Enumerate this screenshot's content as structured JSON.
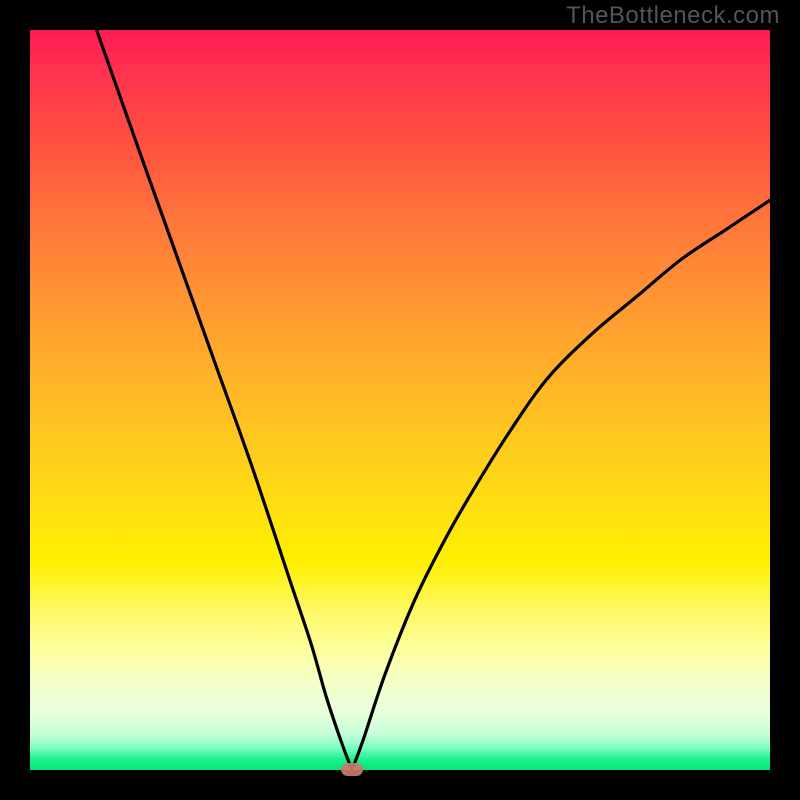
{
  "watermark": "TheBottleneck.com",
  "chart_data": {
    "type": "line",
    "title": "",
    "xlabel": "",
    "ylabel": "",
    "xlim": [
      0,
      100
    ],
    "ylim": [
      0,
      100
    ],
    "grid": false,
    "background_gradient": {
      "stops": [
        {
          "pos": 0,
          "color": "#ff1a55"
        },
        {
          "pos": 0.15,
          "color": "#ff5040"
        },
        {
          "pos": 0.4,
          "color": "#ffa030"
        },
        {
          "pos": 0.65,
          "color": "#ffe010"
        },
        {
          "pos": 0.84,
          "color": "#fdffa0"
        },
        {
          "pos": 0.95,
          "color": "#c8ffd8"
        },
        {
          "pos": 1.0,
          "color": "#00e878"
        }
      ]
    },
    "series": [
      {
        "name": "bottleneck-curve-left",
        "x": [
          9,
          15,
          20,
          25,
          30,
          35,
          38,
          40,
          42,
          43.5
        ],
        "values": [
          100,
          83,
          69,
          55,
          41,
          26,
          17,
          10,
          4,
          0
        ]
      },
      {
        "name": "bottleneck-curve-right",
        "x": [
          43.5,
          45,
          48,
          52,
          56,
          60,
          65,
          70,
          76,
          82,
          88,
          94,
          100
        ],
        "values": [
          0,
          4,
          13,
          23,
          31,
          38,
          46,
          53,
          59,
          64,
          69,
          73,
          77
        ]
      }
    ],
    "marker": {
      "x": 43.5,
      "y": 0,
      "color": "#c97a6d"
    },
    "colors": {
      "curve": "#000000",
      "frame": "#000000"
    }
  }
}
